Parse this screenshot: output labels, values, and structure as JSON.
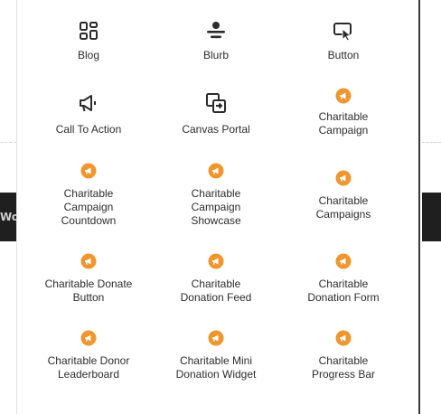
{
  "background": {
    "bar_text": "Wo"
  },
  "modules": [
    {
      "label": "Blog",
      "icon": "grid-layout-icon"
    },
    {
      "label": "Blurb",
      "icon": "blurb-icon"
    },
    {
      "label": "Button",
      "icon": "button-cursor-icon"
    },
    {
      "label": "Call To Action",
      "icon": "megaphone-icon"
    },
    {
      "label": "Canvas Portal",
      "icon": "canvas-portal-icon"
    },
    {
      "label": "Charitable\nCampaign",
      "icon": "charitable-icon"
    },
    {
      "label": "Charitable\nCampaign\nCountdown",
      "icon": "charitable-icon"
    },
    {
      "label": "Charitable\nCampaign\nShowcase",
      "icon": "charitable-icon"
    },
    {
      "label": "Charitable\nCampaigns",
      "icon": "charitable-icon"
    },
    {
      "label": "Charitable Donate\nButton",
      "icon": "charitable-icon"
    },
    {
      "label": "Charitable\nDonation Feed",
      "icon": "charitable-icon"
    },
    {
      "label": "Charitable\nDonation Form",
      "icon": "charitable-icon"
    },
    {
      "label": "Charitable Donor\nLeaderboard",
      "icon": "charitable-icon"
    },
    {
      "label": "Charitable Mini\nDonation Widget",
      "icon": "charitable-icon"
    },
    {
      "label": "Charitable\nProgress Bar",
      "icon": "charitable-icon"
    }
  ],
  "colors": {
    "charitable_accent": "#f0962e",
    "icon_dark": "#2b2b2b"
  }
}
